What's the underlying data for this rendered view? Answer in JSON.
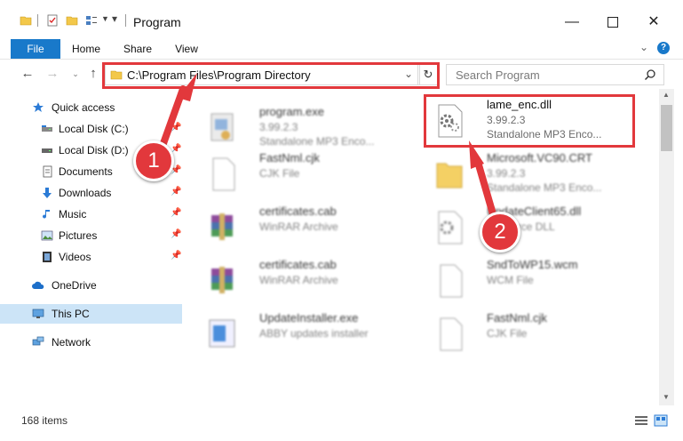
{
  "window": {
    "title": "Program",
    "minimize_icon": "minimize-icon",
    "maximize_icon": "maximize-icon",
    "close_icon": "close-icon"
  },
  "ribbon": {
    "tabs": [
      "File",
      "Home",
      "Share",
      "View"
    ],
    "accent": "#1979ca"
  },
  "address": {
    "path": "C:\\Program Files\\Program Directory",
    "search_placeholder": "Search Program"
  },
  "sidebar": {
    "items": [
      {
        "label": "Quick access",
        "icon": "star-icon"
      },
      {
        "label": "Local Disk (C:)",
        "icon": "drive-icon"
      },
      {
        "label": "Local Disk (D:)",
        "icon": "drive-icon"
      },
      {
        "label": "Documents",
        "icon": "documents-icon"
      },
      {
        "label": "Downloads",
        "icon": "download-icon"
      },
      {
        "label": "Music",
        "icon": "music-icon"
      },
      {
        "label": "Pictures",
        "icon": "pictures-icon"
      },
      {
        "label": "Videos",
        "icon": "video-icon"
      },
      {
        "label": "OneDrive",
        "icon": "cloud-icon"
      },
      {
        "label": "This PC",
        "icon": "computer-icon"
      },
      {
        "label": "Network",
        "icon": "network-icon"
      }
    ]
  },
  "files": [
    {
      "name": "program.exe",
      "version": "3.99.2.3",
      "desc": "Standalone MP3 Enco...",
      "icon": "exe-icon"
    },
    {
      "name": "lame_enc.dll",
      "version": "3.99.2.3",
      "desc": "Standalone MP3 Enco...",
      "icon": "dll-gear-icon"
    },
    {
      "name": "FastNml.cjk",
      "version": "CJK File",
      "desc": "",
      "icon": "file-icon"
    },
    {
      "name": "Microsoft.VC90.CRT",
      "version": "3.99.2.3",
      "desc": "Standalone MP3 Enco...",
      "icon": "folder-icon"
    },
    {
      "name": "certificates.cab",
      "version": "WinRAR Archive",
      "desc": "",
      "icon": "winrar-icon"
    },
    {
      "name": "UpdateClient65.dll",
      "version": "Resource DLL",
      "desc": "",
      "icon": "dll-gear-icon"
    },
    {
      "name": "certificates.cab",
      "version": "WinRAR Archive",
      "desc": "",
      "icon": "winrar-icon"
    },
    {
      "name": "SndToWP15.wcm",
      "version": "WCM File",
      "desc": "",
      "icon": "file-icon"
    },
    {
      "name": "UpdateInstaller.exe",
      "version": "ABBY updates installer",
      "desc": "",
      "icon": "installer-icon"
    },
    {
      "name": "FastNml.cjk",
      "version": "CJK File",
      "desc": "",
      "icon": "file-icon"
    }
  ],
  "status": {
    "count": "168 items"
  },
  "annotations": {
    "badge1": "1",
    "badge2": "2",
    "color": "#e2383c"
  }
}
